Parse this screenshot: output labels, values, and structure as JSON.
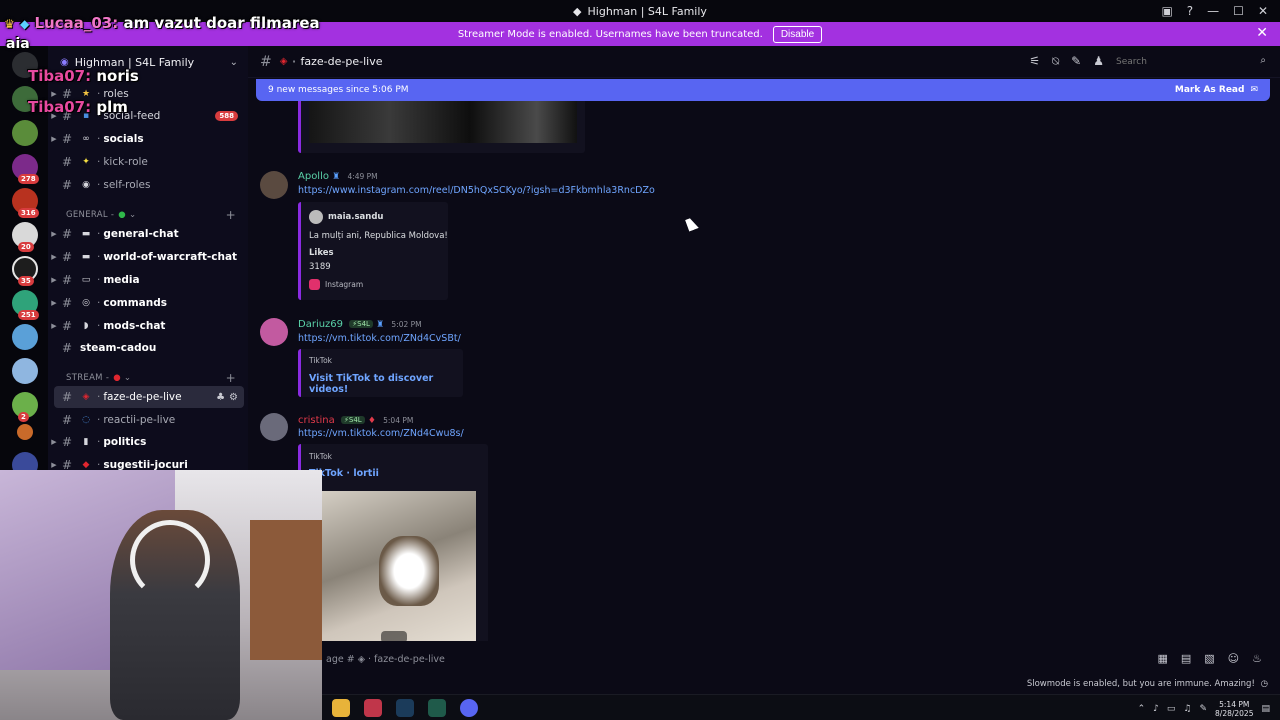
{
  "window": {
    "title": "Highman | S4L Family",
    "controls": [
      "—",
      "☐",
      "✕"
    ]
  },
  "streamer_banner": {
    "text": "Streamer Mode is enabled. Usernames have been truncated.",
    "button": "Disable",
    "close": "✕"
  },
  "server_rail": {
    "badges": [
      "278",
      "316",
      "20",
      "35",
      "251",
      "2"
    ]
  },
  "sidebar": {
    "server_name": "Highman | S4L Family",
    "channels_top": [
      {
        "label": "roles",
        "emoji": "★"
      },
      {
        "label": "social-feed",
        "emoji": "▪",
        "count": "588"
      },
      {
        "label": "socials",
        "emoji": "∞"
      },
      {
        "label": "kick-role",
        "emoji": "✦"
      },
      {
        "label": "self-roles",
        "emoji": "◉"
      }
    ],
    "category_general": "GENERAL -",
    "channels_general": [
      {
        "label": "general-chat",
        "emoji": "▬"
      },
      {
        "label": "world-of-warcraft-chat",
        "emoji": "▬"
      },
      {
        "label": "media",
        "emoji": "▭"
      },
      {
        "label": "commands",
        "emoji": "◎"
      },
      {
        "label": "mods-chat",
        "emoji": "◗"
      },
      {
        "label": "steam-cadou",
        "emoji": ""
      }
    ],
    "category_stream": "STREAM -",
    "channels_stream": [
      {
        "label": "faze-de-pe-live",
        "emoji": "◈",
        "active": true
      },
      {
        "label": "reactii-pe-live",
        "emoji": "◌"
      },
      {
        "label": "politics",
        "emoji": "▮"
      },
      {
        "label": "sugestii-jocuri",
        "emoji": "◆"
      }
    ]
  },
  "chat_header": {
    "channel": "faze-de-pe-live",
    "search_placeholder": "Search"
  },
  "new_messages_bar": {
    "text": "9 new messages since 5:06 PM",
    "mark": "Mark As Read"
  },
  "messages": [
    {
      "author": "Apollo",
      "color": "#5ad1a8",
      "time": "4:49 PM",
      "link": "https://www.instagram.com/reel/DN5hQxSCKyo/?igsh=d3Fkbmhla3RncDZo",
      "embed": {
        "author": "maia.sandu",
        "text": "La mulți ani, Republica Moldova!",
        "field_name": "Likes",
        "field_value": "3189",
        "provider": "Instagram"
      }
    },
    {
      "author": "Dariuz69",
      "color": "#5ad1a8",
      "tag": "S4L",
      "time": "5:02 PM",
      "link": "https://vm.tiktok.com/ZNd4CvSBt/",
      "embed": {
        "provider": "TikTok",
        "title": "Visit TikTok to discover videos!"
      }
    },
    {
      "author": "cristina",
      "color": "#e03a4a",
      "tag": "S4L",
      "time": "5:04 PM",
      "link": "https://vm.tiktok.com/ZNd4Cwu8s/",
      "embed": {
        "provider": "TikTok",
        "title": "TikTok · lortii"
      }
    }
  ],
  "composer": {
    "placeholder": "age # ◈ · faze-de-pe-live",
    "slowmode": "Slowmode is enabled, but you are immune. Amazing!"
  },
  "taskbar": {
    "time": "5:14 PM",
    "date": "8/28/2025"
  },
  "stream_overlay": [
    {
      "user": "Lucaa_03:",
      "text": "am vazut doar filmarea"
    },
    {
      "user": "aia",
      "text": ""
    },
    {
      "user": "Tiba07:",
      "text": "noris"
    },
    {
      "user": "Tiba07:",
      "text": "plm"
    }
  ],
  "colors": {
    "accent": "#5865f2",
    "streamer_banner": "#a331e0",
    "background": "#0b0a16",
    "link": "#6fa5ff"
  }
}
